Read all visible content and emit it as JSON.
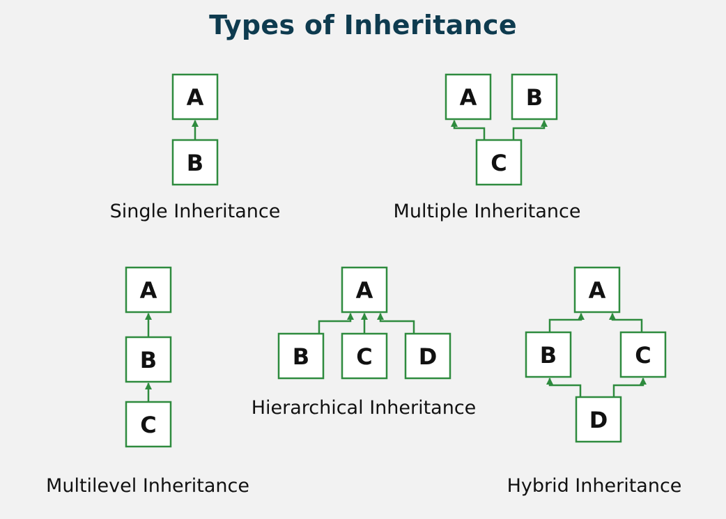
{
  "title": "Types of Inheritance",
  "colors": {
    "title": "#0e3b4f",
    "stroke": "#2e8b3e",
    "text": "#111111",
    "background": "#f2f2f2"
  },
  "diagrams": {
    "single": {
      "caption": "Single Inheritance",
      "nodes": {
        "a": "A",
        "b": "B"
      }
    },
    "multiple": {
      "caption": "Multiple Inheritance",
      "nodes": {
        "a": "A",
        "b": "B",
        "c": "C"
      }
    },
    "multilevel": {
      "caption": "Multilevel Inheritance",
      "nodes": {
        "a": "A",
        "b": "B",
        "c": "C"
      }
    },
    "hierarchical": {
      "caption": "Hierarchical Inheritance",
      "nodes": {
        "a": "A",
        "b": "B",
        "c": "C",
        "d": "D"
      }
    },
    "hybrid": {
      "caption": "Hybrid Inheritance",
      "nodes": {
        "a": "A",
        "b": "B",
        "c": "C",
        "d": "D"
      }
    }
  }
}
